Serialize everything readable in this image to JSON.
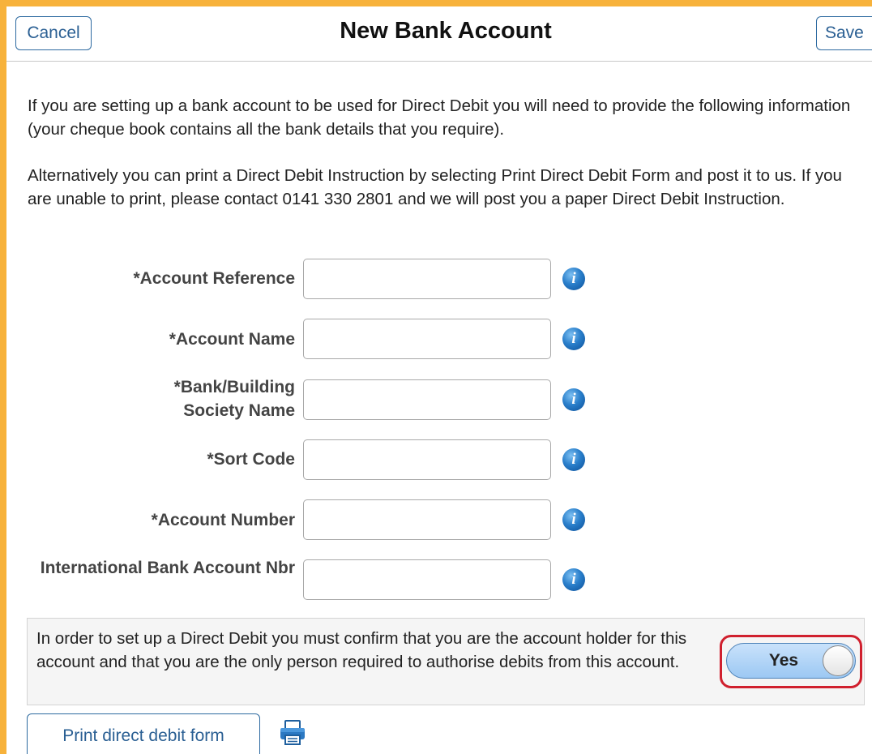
{
  "header": {
    "title": "New Bank Account",
    "cancel_label": "Cancel",
    "save_label": "Save"
  },
  "intro": {
    "paragraph1": "If you are setting up a bank account to be used for Direct Debit you will need to provide the following information (your cheque book contains all the bank details that you require).",
    "paragraph2": "Alternatively you can print a Direct Debit Instruction by selecting Print Direct Debit Form and post it to us. If you are unable to print, please contact 0141 330 2801 and we will post you a paper Direct Debit Instruction."
  },
  "form": {
    "fields": [
      {
        "label": "*Account Reference",
        "value": ""
      },
      {
        "label": "*Account Name",
        "value": ""
      },
      {
        "label": "*Bank/Building Society Name",
        "value": ""
      },
      {
        "label": "*Sort Code",
        "value": ""
      },
      {
        "label": "*Account Number",
        "value": ""
      },
      {
        "label": "International Bank Account Nbr",
        "value": ""
      }
    ],
    "info_icon": "info-icon"
  },
  "confirm": {
    "text": "In order to set up a Direct Debit you must confirm that you are the account holder for this account and that you are the only person required to authorise debits from this account.",
    "toggle_label": "Yes",
    "toggle_highlight_color": "#d0202e"
  },
  "footer": {
    "print_label": "Print direct debit form",
    "printer_icon": "printer-icon"
  },
  "colors": {
    "background": "#f7b23b",
    "accent": "#2a5f93"
  }
}
